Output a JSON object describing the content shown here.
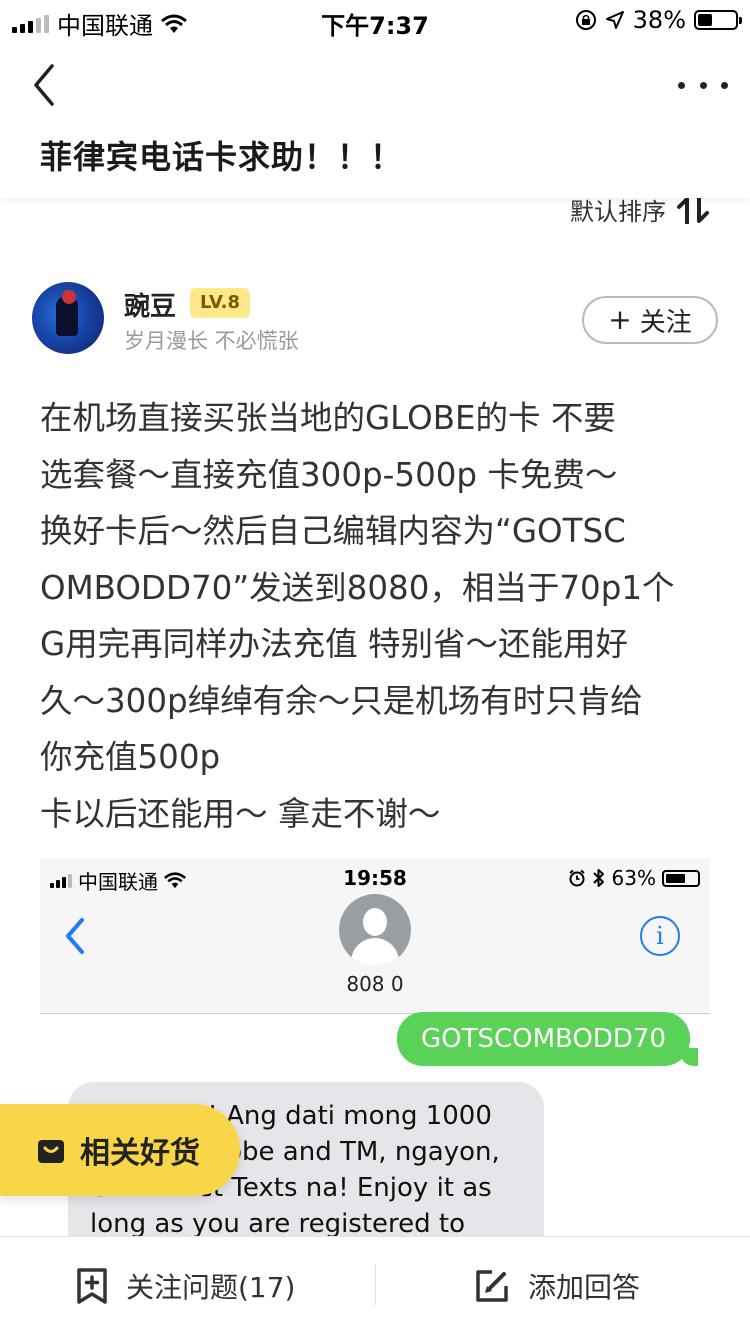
{
  "status_bar": {
    "carrier": "中国联通",
    "time": "下午7:37",
    "battery": "38%",
    "battery_level": 0.38
  },
  "header": {
    "title": "菲律宾电话卡求助！！！"
  },
  "sort": {
    "label": "默认排序"
  },
  "answer": {
    "author": {
      "name": "豌豆",
      "level": "LV.8",
      "bio": "岁月漫长 不必慌张"
    },
    "follow_label": "关注",
    "lines": [
      "在机场直接买张当地的GLOBE的卡 不要",
      "选套餐～直接充值300p-500p 卡免费～",
      "换好卡后～然后自己编辑内容为“GOTSC",
      "OMBODD70”发送到8080，相当于70p1个",
      "G用完再同样办法充值 特别省～还能用好",
      "久～300p绰绰有余～只是机场有时只肯给",
      "你充值500p",
      "卡以后还能用～ 拿走不谢～"
    ]
  },
  "embedded_screenshot": {
    "carrier": "中国联通",
    "time": "19:58",
    "battery": "63%",
    "battery_level": 0.63,
    "contact": "808 0",
    "sent_message": "GOTSCOMBODD70",
    "received_message": "Congrats! Ang dati mong 1000 Texts to Globe and TM, ngayon, Unli Allnet Texts na! Enjoy it as long as you are registered to"
  },
  "goods_button": {
    "label": "相关好货"
  },
  "bottom_bar": {
    "follow_question": "关注问题(17)",
    "add_answer": "添加回答"
  }
}
